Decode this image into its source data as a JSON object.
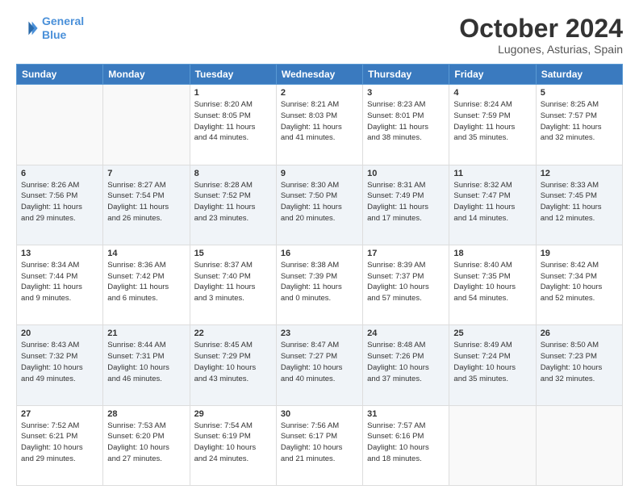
{
  "header": {
    "logo_line1": "General",
    "logo_line2": "Blue",
    "month": "October 2024",
    "location": "Lugones, Asturias, Spain"
  },
  "weekdays": [
    "Sunday",
    "Monday",
    "Tuesday",
    "Wednesday",
    "Thursday",
    "Friday",
    "Saturday"
  ],
  "weeks": [
    [
      {
        "day": "",
        "info": ""
      },
      {
        "day": "",
        "info": ""
      },
      {
        "day": "1",
        "info": "Sunrise: 8:20 AM\nSunset: 8:05 PM\nDaylight: 11 hours\nand 44 minutes."
      },
      {
        "day": "2",
        "info": "Sunrise: 8:21 AM\nSunset: 8:03 PM\nDaylight: 11 hours\nand 41 minutes."
      },
      {
        "day": "3",
        "info": "Sunrise: 8:23 AM\nSunset: 8:01 PM\nDaylight: 11 hours\nand 38 minutes."
      },
      {
        "day": "4",
        "info": "Sunrise: 8:24 AM\nSunset: 7:59 PM\nDaylight: 11 hours\nand 35 minutes."
      },
      {
        "day": "5",
        "info": "Sunrise: 8:25 AM\nSunset: 7:57 PM\nDaylight: 11 hours\nand 32 minutes."
      }
    ],
    [
      {
        "day": "6",
        "info": "Sunrise: 8:26 AM\nSunset: 7:56 PM\nDaylight: 11 hours\nand 29 minutes."
      },
      {
        "day": "7",
        "info": "Sunrise: 8:27 AM\nSunset: 7:54 PM\nDaylight: 11 hours\nand 26 minutes."
      },
      {
        "day": "8",
        "info": "Sunrise: 8:28 AM\nSunset: 7:52 PM\nDaylight: 11 hours\nand 23 minutes."
      },
      {
        "day": "9",
        "info": "Sunrise: 8:30 AM\nSunset: 7:50 PM\nDaylight: 11 hours\nand 20 minutes."
      },
      {
        "day": "10",
        "info": "Sunrise: 8:31 AM\nSunset: 7:49 PM\nDaylight: 11 hours\nand 17 minutes."
      },
      {
        "day": "11",
        "info": "Sunrise: 8:32 AM\nSunset: 7:47 PM\nDaylight: 11 hours\nand 14 minutes."
      },
      {
        "day": "12",
        "info": "Sunrise: 8:33 AM\nSunset: 7:45 PM\nDaylight: 11 hours\nand 12 minutes."
      }
    ],
    [
      {
        "day": "13",
        "info": "Sunrise: 8:34 AM\nSunset: 7:44 PM\nDaylight: 11 hours\nand 9 minutes."
      },
      {
        "day": "14",
        "info": "Sunrise: 8:36 AM\nSunset: 7:42 PM\nDaylight: 11 hours\nand 6 minutes."
      },
      {
        "day": "15",
        "info": "Sunrise: 8:37 AM\nSunset: 7:40 PM\nDaylight: 11 hours\nand 3 minutes."
      },
      {
        "day": "16",
        "info": "Sunrise: 8:38 AM\nSunset: 7:39 PM\nDaylight: 11 hours\nand 0 minutes."
      },
      {
        "day": "17",
        "info": "Sunrise: 8:39 AM\nSunset: 7:37 PM\nDaylight: 10 hours\nand 57 minutes."
      },
      {
        "day": "18",
        "info": "Sunrise: 8:40 AM\nSunset: 7:35 PM\nDaylight: 10 hours\nand 54 minutes."
      },
      {
        "day": "19",
        "info": "Sunrise: 8:42 AM\nSunset: 7:34 PM\nDaylight: 10 hours\nand 52 minutes."
      }
    ],
    [
      {
        "day": "20",
        "info": "Sunrise: 8:43 AM\nSunset: 7:32 PM\nDaylight: 10 hours\nand 49 minutes."
      },
      {
        "day": "21",
        "info": "Sunrise: 8:44 AM\nSunset: 7:31 PM\nDaylight: 10 hours\nand 46 minutes."
      },
      {
        "day": "22",
        "info": "Sunrise: 8:45 AM\nSunset: 7:29 PM\nDaylight: 10 hours\nand 43 minutes."
      },
      {
        "day": "23",
        "info": "Sunrise: 8:47 AM\nSunset: 7:27 PM\nDaylight: 10 hours\nand 40 minutes."
      },
      {
        "day": "24",
        "info": "Sunrise: 8:48 AM\nSunset: 7:26 PM\nDaylight: 10 hours\nand 37 minutes."
      },
      {
        "day": "25",
        "info": "Sunrise: 8:49 AM\nSunset: 7:24 PM\nDaylight: 10 hours\nand 35 minutes."
      },
      {
        "day": "26",
        "info": "Sunrise: 8:50 AM\nSunset: 7:23 PM\nDaylight: 10 hours\nand 32 minutes."
      }
    ],
    [
      {
        "day": "27",
        "info": "Sunrise: 7:52 AM\nSunset: 6:21 PM\nDaylight: 10 hours\nand 29 minutes."
      },
      {
        "day": "28",
        "info": "Sunrise: 7:53 AM\nSunset: 6:20 PM\nDaylight: 10 hours\nand 27 minutes."
      },
      {
        "day": "29",
        "info": "Sunrise: 7:54 AM\nSunset: 6:19 PM\nDaylight: 10 hours\nand 24 minutes."
      },
      {
        "day": "30",
        "info": "Sunrise: 7:56 AM\nSunset: 6:17 PM\nDaylight: 10 hours\nand 21 minutes."
      },
      {
        "day": "31",
        "info": "Sunrise: 7:57 AM\nSunset: 6:16 PM\nDaylight: 10 hours\nand 18 minutes."
      },
      {
        "day": "",
        "info": ""
      },
      {
        "day": "",
        "info": ""
      }
    ]
  ]
}
